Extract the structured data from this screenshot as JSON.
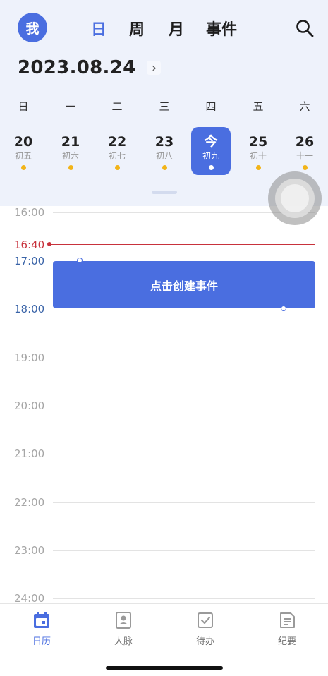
{
  "header": {
    "avatar_label": "我",
    "view_tabs": [
      {
        "label": "日",
        "active": true
      },
      {
        "label": "周",
        "active": false
      },
      {
        "label": "月",
        "active": false
      },
      {
        "label": "事件",
        "active": false
      }
    ],
    "search_icon": "search-icon",
    "current_date": "2023.08.24",
    "date_chevron": "›"
  },
  "week": {
    "weekdays": [
      "日",
      "一",
      "二",
      "三",
      "四",
      "五",
      "六"
    ],
    "days": [
      {
        "num": "20",
        "lunar": "初五",
        "has_event": true,
        "today": false
      },
      {
        "num": "21",
        "lunar": "初六",
        "has_event": true,
        "today": false
      },
      {
        "num": "22",
        "lunar": "初七",
        "has_event": true,
        "today": false
      },
      {
        "num": "23",
        "lunar": "初八",
        "has_event": true,
        "today": false
      },
      {
        "num": "今",
        "lunar": "初九",
        "has_event": true,
        "today": true
      },
      {
        "num": "25",
        "lunar": "初十",
        "has_event": true,
        "today": false
      },
      {
        "num": "26",
        "lunar": "十一",
        "has_event": true,
        "today": false
      }
    ]
  },
  "timeline": {
    "hours": [
      "16:00",
      "17:00",
      "18:00",
      "19:00",
      "20:00",
      "21:00",
      "22:00",
      "23:00",
      "24:00"
    ],
    "now_time": "16:40",
    "event_label": "点击创建事件"
  },
  "bottom_nav": {
    "items": [
      {
        "label": "日历",
        "icon": "calendar-icon",
        "active": true
      },
      {
        "label": "人脉",
        "icon": "contacts-icon",
        "active": false
      },
      {
        "label": "待办",
        "icon": "todo-check-icon",
        "active": false
      },
      {
        "label": "纪要",
        "icon": "notes-icon",
        "active": false
      }
    ]
  },
  "colors": {
    "accent": "#4a6ee0",
    "header_bg": "#eef2fb",
    "now_line": "#c8323c",
    "event_dot": "#f2b418"
  }
}
